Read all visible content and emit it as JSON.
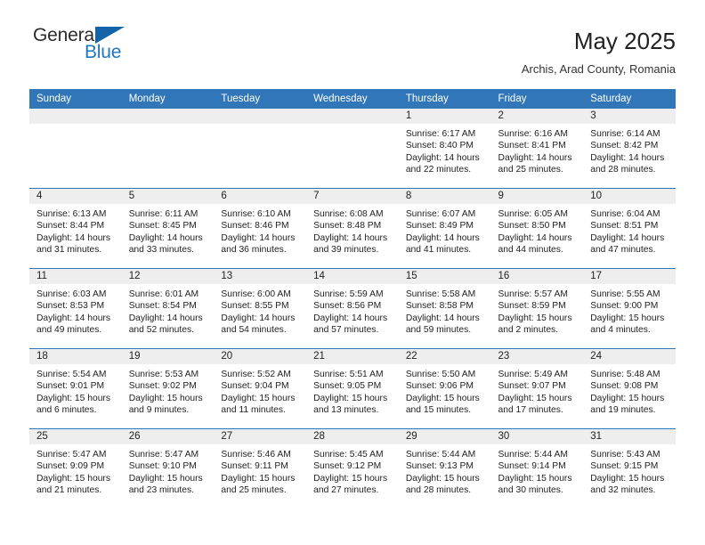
{
  "brand": {
    "name_top": "General",
    "name_bottom": "Blue",
    "triangle_icon": "blue-triangle-icon",
    "color_top": "#2b2b2b",
    "color_bottom": "#1f77c4"
  },
  "header": {
    "title": "May 2025",
    "subtitle": "Archis, Arad County, Romania"
  },
  "theme": {
    "header_bg": "#3076b8",
    "header_text": "#ffffff",
    "daynum_band_bg": "#eeeeee",
    "cell_bg": "#ffffff",
    "row_divider": "#3076b8"
  },
  "calendar": {
    "weekday_headers": [
      "Sunday",
      "Monday",
      "Tuesday",
      "Wednesday",
      "Thursday",
      "Friday",
      "Saturday"
    ],
    "weeks": [
      [
        {
          "day": "",
          "sunrise": "",
          "sunset": "",
          "daylight_line1": "",
          "daylight_line2": "",
          "empty": true
        },
        {
          "day": "",
          "sunrise": "",
          "sunset": "",
          "daylight_line1": "",
          "daylight_line2": "",
          "empty": true
        },
        {
          "day": "",
          "sunrise": "",
          "sunset": "",
          "daylight_line1": "",
          "daylight_line2": "",
          "empty": true
        },
        {
          "day": "",
          "sunrise": "",
          "sunset": "",
          "daylight_line1": "",
          "daylight_line2": "",
          "empty": true
        },
        {
          "day": "1",
          "sunrise": "Sunrise: 6:17 AM",
          "sunset": "Sunset: 8:40 PM",
          "daylight_line1": "Daylight: 14 hours",
          "daylight_line2": "and 22 minutes."
        },
        {
          "day": "2",
          "sunrise": "Sunrise: 6:16 AM",
          "sunset": "Sunset: 8:41 PM",
          "daylight_line1": "Daylight: 14 hours",
          "daylight_line2": "and 25 minutes."
        },
        {
          "day": "3",
          "sunrise": "Sunrise: 6:14 AM",
          "sunset": "Sunset: 8:42 PM",
          "daylight_line1": "Daylight: 14 hours",
          "daylight_line2": "and 28 minutes."
        }
      ],
      [
        {
          "day": "4",
          "sunrise": "Sunrise: 6:13 AM",
          "sunset": "Sunset: 8:44 PM",
          "daylight_line1": "Daylight: 14 hours",
          "daylight_line2": "and 31 minutes."
        },
        {
          "day": "5",
          "sunrise": "Sunrise: 6:11 AM",
          "sunset": "Sunset: 8:45 PM",
          "daylight_line1": "Daylight: 14 hours",
          "daylight_line2": "and 33 minutes."
        },
        {
          "day": "6",
          "sunrise": "Sunrise: 6:10 AM",
          "sunset": "Sunset: 8:46 PM",
          "daylight_line1": "Daylight: 14 hours",
          "daylight_line2": "and 36 minutes."
        },
        {
          "day": "7",
          "sunrise": "Sunrise: 6:08 AM",
          "sunset": "Sunset: 8:48 PM",
          "daylight_line1": "Daylight: 14 hours",
          "daylight_line2": "and 39 minutes."
        },
        {
          "day": "8",
          "sunrise": "Sunrise: 6:07 AM",
          "sunset": "Sunset: 8:49 PM",
          "daylight_line1": "Daylight: 14 hours",
          "daylight_line2": "and 41 minutes."
        },
        {
          "day": "9",
          "sunrise": "Sunrise: 6:05 AM",
          "sunset": "Sunset: 8:50 PM",
          "daylight_line1": "Daylight: 14 hours",
          "daylight_line2": "and 44 minutes."
        },
        {
          "day": "10",
          "sunrise": "Sunrise: 6:04 AM",
          "sunset": "Sunset: 8:51 PM",
          "daylight_line1": "Daylight: 14 hours",
          "daylight_line2": "and 47 minutes."
        }
      ],
      [
        {
          "day": "11",
          "sunrise": "Sunrise: 6:03 AM",
          "sunset": "Sunset: 8:53 PM",
          "daylight_line1": "Daylight: 14 hours",
          "daylight_line2": "and 49 minutes."
        },
        {
          "day": "12",
          "sunrise": "Sunrise: 6:01 AM",
          "sunset": "Sunset: 8:54 PM",
          "daylight_line1": "Daylight: 14 hours",
          "daylight_line2": "and 52 minutes."
        },
        {
          "day": "13",
          "sunrise": "Sunrise: 6:00 AM",
          "sunset": "Sunset: 8:55 PM",
          "daylight_line1": "Daylight: 14 hours",
          "daylight_line2": "and 54 minutes."
        },
        {
          "day": "14",
          "sunrise": "Sunrise: 5:59 AM",
          "sunset": "Sunset: 8:56 PM",
          "daylight_line1": "Daylight: 14 hours",
          "daylight_line2": "and 57 minutes."
        },
        {
          "day": "15",
          "sunrise": "Sunrise: 5:58 AM",
          "sunset": "Sunset: 8:58 PM",
          "daylight_line1": "Daylight: 14 hours",
          "daylight_line2": "and 59 minutes."
        },
        {
          "day": "16",
          "sunrise": "Sunrise: 5:57 AM",
          "sunset": "Sunset: 8:59 PM",
          "daylight_line1": "Daylight: 15 hours",
          "daylight_line2": "and 2 minutes."
        },
        {
          "day": "17",
          "sunrise": "Sunrise: 5:55 AM",
          "sunset": "Sunset: 9:00 PM",
          "daylight_line1": "Daylight: 15 hours",
          "daylight_line2": "and 4 minutes."
        }
      ],
      [
        {
          "day": "18",
          "sunrise": "Sunrise: 5:54 AM",
          "sunset": "Sunset: 9:01 PM",
          "daylight_line1": "Daylight: 15 hours",
          "daylight_line2": "and 6 minutes."
        },
        {
          "day": "19",
          "sunrise": "Sunrise: 5:53 AM",
          "sunset": "Sunset: 9:02 PM",
          "daylight_line1": "Daylight: 15 hours",
          "daylight_line2": "and 9 minutes."
        },
        {
          "day": "20",
          "sunrise": "Sunrise: 5:52 AM",
          "sunset": "Sunset: 9:04 PM",
          "daylight_line1": "Daylight: 15 hours",
          "daylight_line2": "and 11 minutes."
        },
        {
          "day": "21",
          "sunrise": "Sunrise: 5:51 AM",
          "sunset": "Sunset: 9:05 PM",
          "daylight_line1": "Daylight: 15 hours",
          "daylight_line2": "and 13 minutes."
        },
        {
          "day": "22",
          "sunrise": "Sunrise: 5:50 AM",
          "sunset": "Sunset: 9:06 PM",
          "daylight_line1": "Daylight: 15 hours",
          "daylight_line2": "and 15 minutes."
        },
        {
          "day": "23",
          "sunrise": "Sunrise: 5:49 AM",
          "sunset": "Sunset: 9:07 PM",
          "daylight_line1": "Daylight: 15 hours",
          "daylight_line2": "and 17 minutes."
        },
        {
          "day": "24",
          "sunrise": "Sunrise: 5:48 AM",
          "sunset": "Sunset: 9:08 PM",
          "daylight_line1": "Daylight: 15 hours",
          "daylight_line2": "and 19 minutes."
        }
      ],
      [
        {
          "day": "25",
          "sunrise": "Sunrise: 5:47 AM",
          "sunset": "Sunset: 9:09 PM",
          "daylight_line1": "Daylight: 15 hours",
          "daylight_line2": "and 21 minutes."
        },
        {
          "day": "26",
          "sunrise": "Sunrise: 5:47 AM",
          "sunset": "Sunset: 9:10 PM",
          "daylight_line1": "Daylight: 15 hours",
          "daylight_line2": "and 23 minutes."
        },
        {
          "day": "27",
          "sunrise": "Sunrise: 5:46 AM",
          "sunset": "Sunset: 9:11 PM",
          "daylight_line1": "Daylight: 15 hours",
          "daylight_line2": "and 25 minutes."
        },
        {
          "day": "28",
          "sunrise": "Sunrise: 5:45 AM",
          "sunset": "Sunset: 9:12 PM",
          "daylight_line1": "Daylight: 15 hours",
          "daylight_line2": "and 27 minutes."
        },
        {
          "day": "29",
          "sunrise": "Sunrise: 5:44 AM",
          "sunset": "Sunset: 9:13 PM",
          "daylight_line1": "Daylight: 15 hours",
          "daylight_line2": "and 28 minutes."
        },
        {
          "day": "30",
          "sunrise": "Sunrise: 5:44 AM",
          "sunset": "Sunset: 9:14 PM",
          "daylight_line1": "Daylight: 15 hours",
          "daylight_line2": "and 30 minutes."
        },
        {
          "day": "31",
          "sunrise": "Sunrise: 5:43 AM",
          "sunset": "Sunset: 9:15 PM",
          "daylight_line1": "Daylight: 15 hours",
          "daylight_line2": "and 32 minutes."
        }
      ]
    ]
  }
}
